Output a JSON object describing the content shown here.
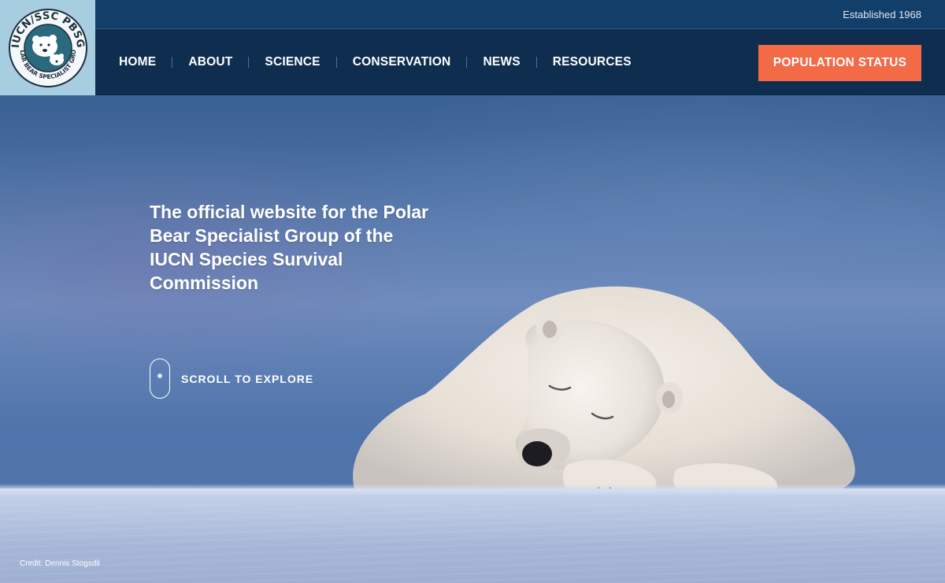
{
  "header": {
    "established": "Established 1968",
    "logo": {
      "top_text": "IUCN/SSC PBSG",
      "ring_text": "POLAR BEAR SPECIALIST GROUP"
    }
  },
  "nav": {
    "items": [
      {
        "label": "HOME"
      },
      {
        "label": "ABOUT"
      },
      {
        "label": "SCIENCE"
      },
      {
        "label": "CONSERVATION"
      },
      {
        "label": "NEWS"
      },
      {
        "label": "RESOURCES"
      }
    ],
    "cta_label": "POPULATION STATUS"
  },
  "hero": {
    "title": "The official website for the Polar Bear Specialist Group of the IUCN Species Survival Commission",
    "scroll_label": "SCROLL TO EXPLORE",
    "credit": "Credit: Dennis Stogsdil"
  },
  "colors": {
    "topbar": "#123f6a",
    "navbar": "#0f2e4f",
    "cta": "#f36a47",
    "logo_bg": "#a7cde0"
  },
  "icons": [
    "pbsg-logo",
    "scroll-mouse-icon"
  ]
}
